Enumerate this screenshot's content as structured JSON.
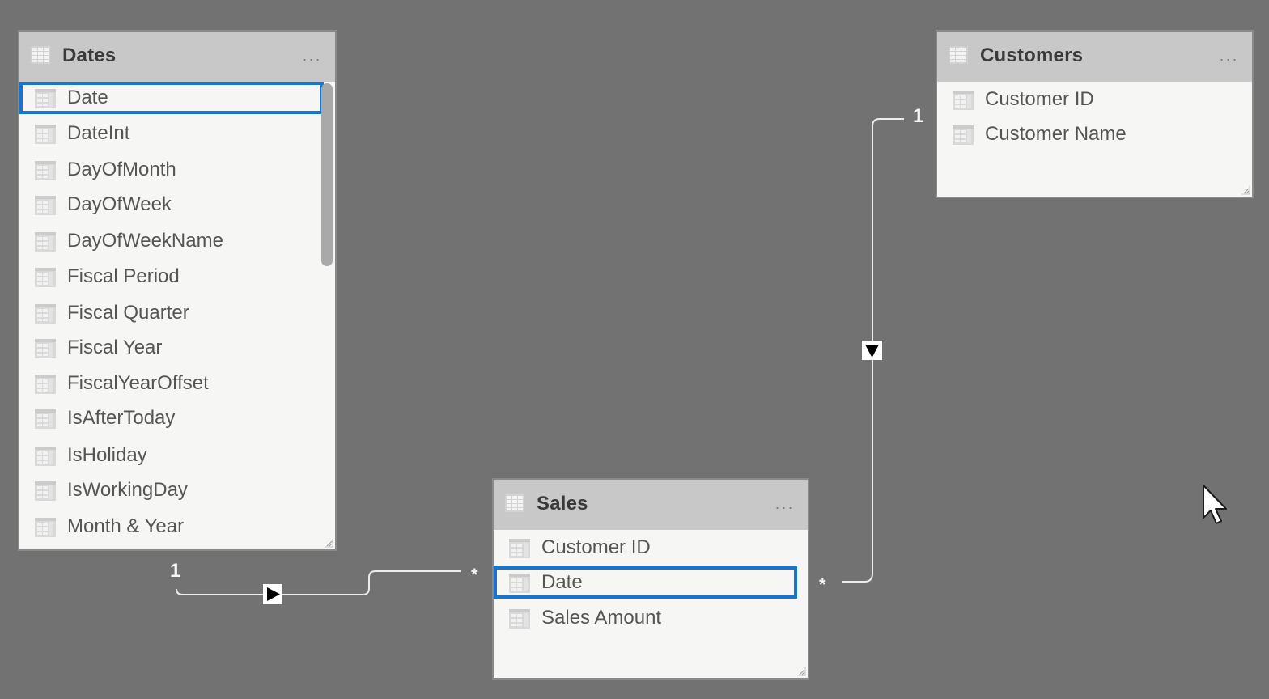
{
  "tables": {
    "dates": {
      "title": "Dates",
      "more_label": "...",
      "fields": [
        "Date",
        "DateInt",
        "DayOfMonth",
        "DayOfWeek",
        "DayOfWeekName",
        "Fiscal Period",
        "Fiscal Quarter",
        "Fiscal Year",
        "FiscalYearOffset",
        "IsAfterToday",
        "IsHoliday",
        "IsWorkingDay",
        "Month & Year"
      ],
      "selected_field": "Date"
    },
    "customers": {
      "title": "Customers",
      "more_label": "...",
      "fields": [
        "Customer ID",
        "Customer Name"
      ]
    },
    "sales": {
      "title": "Sales",
      "more_label": "...",
      "fields": [
        "Customer ID",
        "Date",
        "Sales Amount"
      ],
      "selected_field": "Date"
    }
  },
  "relationships": [
    {
      "from_table": "Dates",
      "from_field": "Date",
      "from_cardinality": "1",
      "to_table": "Sales",
      "to_field": "Date",
      "to_cardinality": "*",
      "filter_direction": "right"
    },
    {
      "from_table": "Customers",
      "from_field": "Customer ID",
      "from_cardinality": "1",
      "to_table": "Sales",
      "to_field": "Customer ID",
      "to_cardinality": "*",
      "filter_direction": "down"
    }
  ],
  "colors": {
    "canvas": "#727272",
    "selection": "#1874cd",
    "header": "#c8c8c8",
    "card": "#f6f6f5"
  }
}
